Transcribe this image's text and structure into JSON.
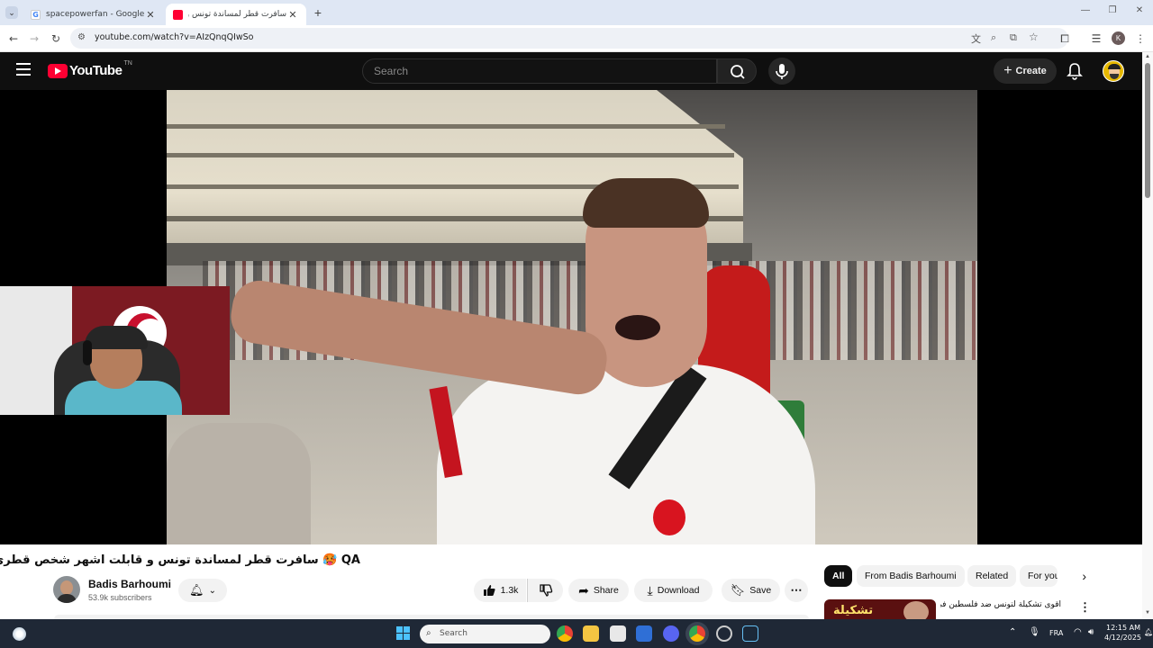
{
  "browser": {
    "tabs": [
      {
        "title": "spacepowerfan - Google Search",
        "active": false
      },
      {
        "title": "سافرت قطر لمساندة تونس و قابا",
        "active": true
      }
    ],
    "new_tab": "+",
    "url": "youtube.com/watch?v=AIzQnqQIwSo",
    "profile_initial": "K",
    "window_controls": [
      "—",
      "❐",
      "✕"
    ]
  },
  "youtube": {
    "logo_text": "YouTube",
    "logo_region": "TN",
    "search_placeholder": "Search",
    "create_label": "Create"
  },
  "video": {
    "title": "QA 🥵 سافرت قطر لمساندة تونس و قابلت اشهر شخص قطري",
    "channel": {
      "name": "Badis Barhoumi",
      "subscribers": "53.9k subscribers"
    },
    "likes": "1.3k",
    "share_label": "Share",
    "download_label": "Download",
    "save_label": "Save"
  },
  "chips": [
    "All",
    "From Badis Barhoumi",
    "Related",
    "For you"
  ],
  "recommendation": {
    "title": "أقوى تشكيلة لتونس ضد فلسطين في كأس العرب",
    "thumb_text": "تشكيلة"
  },
  "taskbar": {
    "search_placeholder": "Search",
    "language": "FRA",
    "time": "12:15 AM",
    "date": "4/12/2025"
  },
  "colors": {
    "yt_red": "#ff0033",
    "tab_bg": "#dfe7f4",
    "taskbar": "#1f2836",
    "chip_active": "#0f0f0f"
  }
}
